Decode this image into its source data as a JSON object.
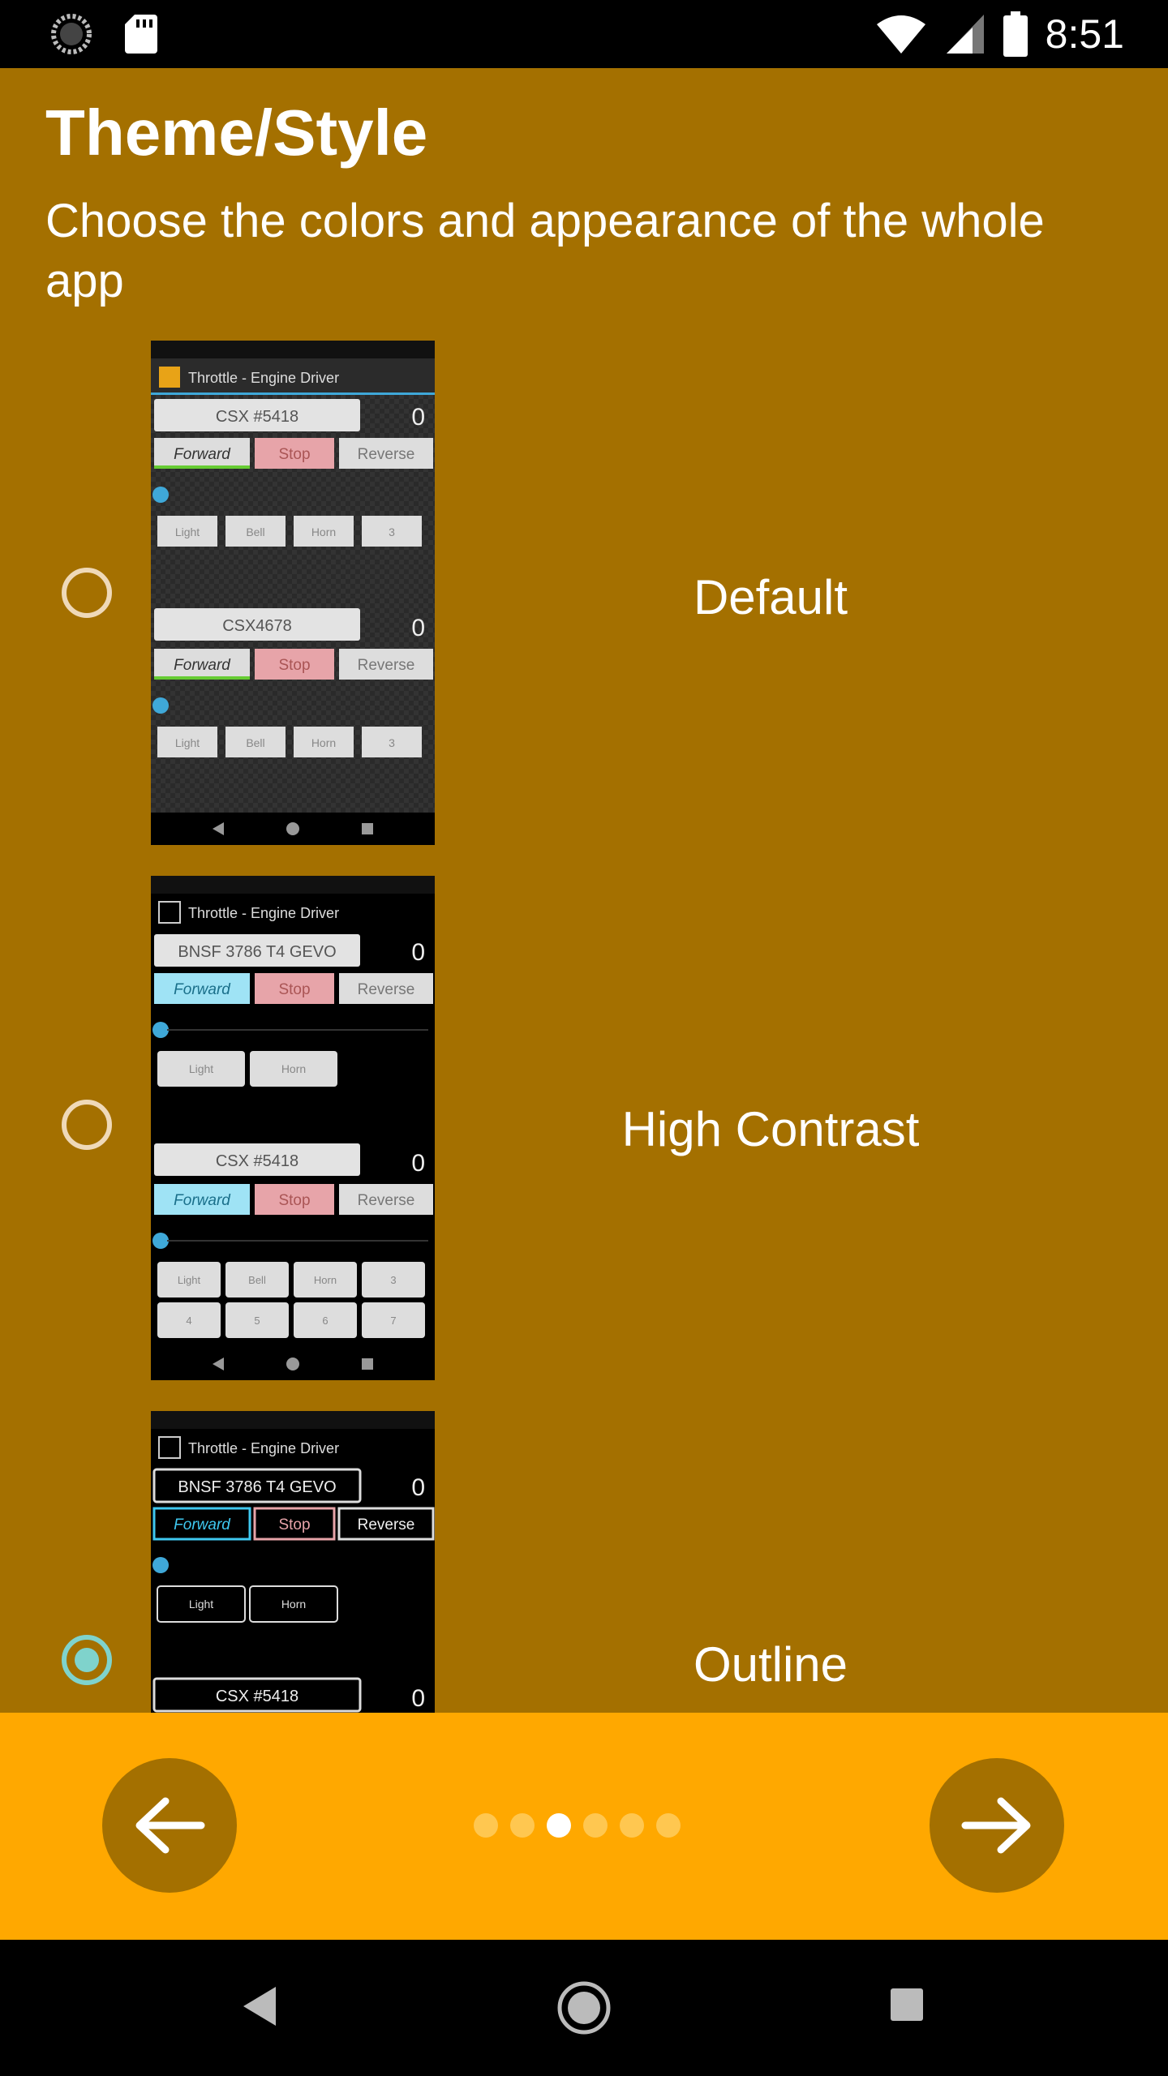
{
  "status_bar": {
    "time": "8:51"
  },
  "page": {
    "title": "Theme/Style",
    "subtitle": "Choose the colors and appearance of the whole app"
  },
  "options": [
    {
      "label": "Default",
      "selected": false,
      "thumb": {
        "app_title": "Throttle - Engine Driver",
        "loco1": "CSX #5418",
        "loco2": "CSX4678",
        "speed": "0",
        "forward": "Forward",
        "stop": "Stop",
        "reverse": "Reverse",
        "fn1": "Light",
        "fn2": "Bell",
        "fn3": "Horn",
        "fn4": "3"
      }
    },
    {
      "label": "High Contrast",
      "selected": false,
      "thumb": {
        "app_title": "Throttle - Engine Driver",
        "loco1": "BNSF 3786 T4 GEVO",
        "loco2": "CSX #5418",
        "speed": "0",
        "forward": "Forward",
        "stop": "Stop",
        "reverse": "Reverse",
        "fn1": "Light",
        "fn2": "Horn",
        "fn_row": [
          "Light",
          "Bell",
          "Horn",
          "3"
        ],
        "fn_row2": [
          "4",
          "5",
          "6",
          "7"
        ]
      }
    },
    {
      "label": "Outline",
      "selected": true,
      "thumb": {
        "app_title": "Throttle - Engine Driver",
        "loco1": "BNSF 3786 T4 GEVO",
        "loco2": "CSX #5418",
        "speed": "0",
        "forward": "Forward",
        "stop": "Stop",
        "reverse": "Reverse",
        "fn1": "Light",
        "fn2": "Horn"
      }
    }
  ],
  "pager": {
    "page_count": 6,
    "current_page": 3
  },
  "icons": {
    "back": "arrow-left-icon",
    "next": "arrow-right-icon"
  },
  "colors": {
    "content_bg": "#A47000",
    "pager_bg": "#FFA800",
    "radio_checked": "#7FD3CC"
  }
}
